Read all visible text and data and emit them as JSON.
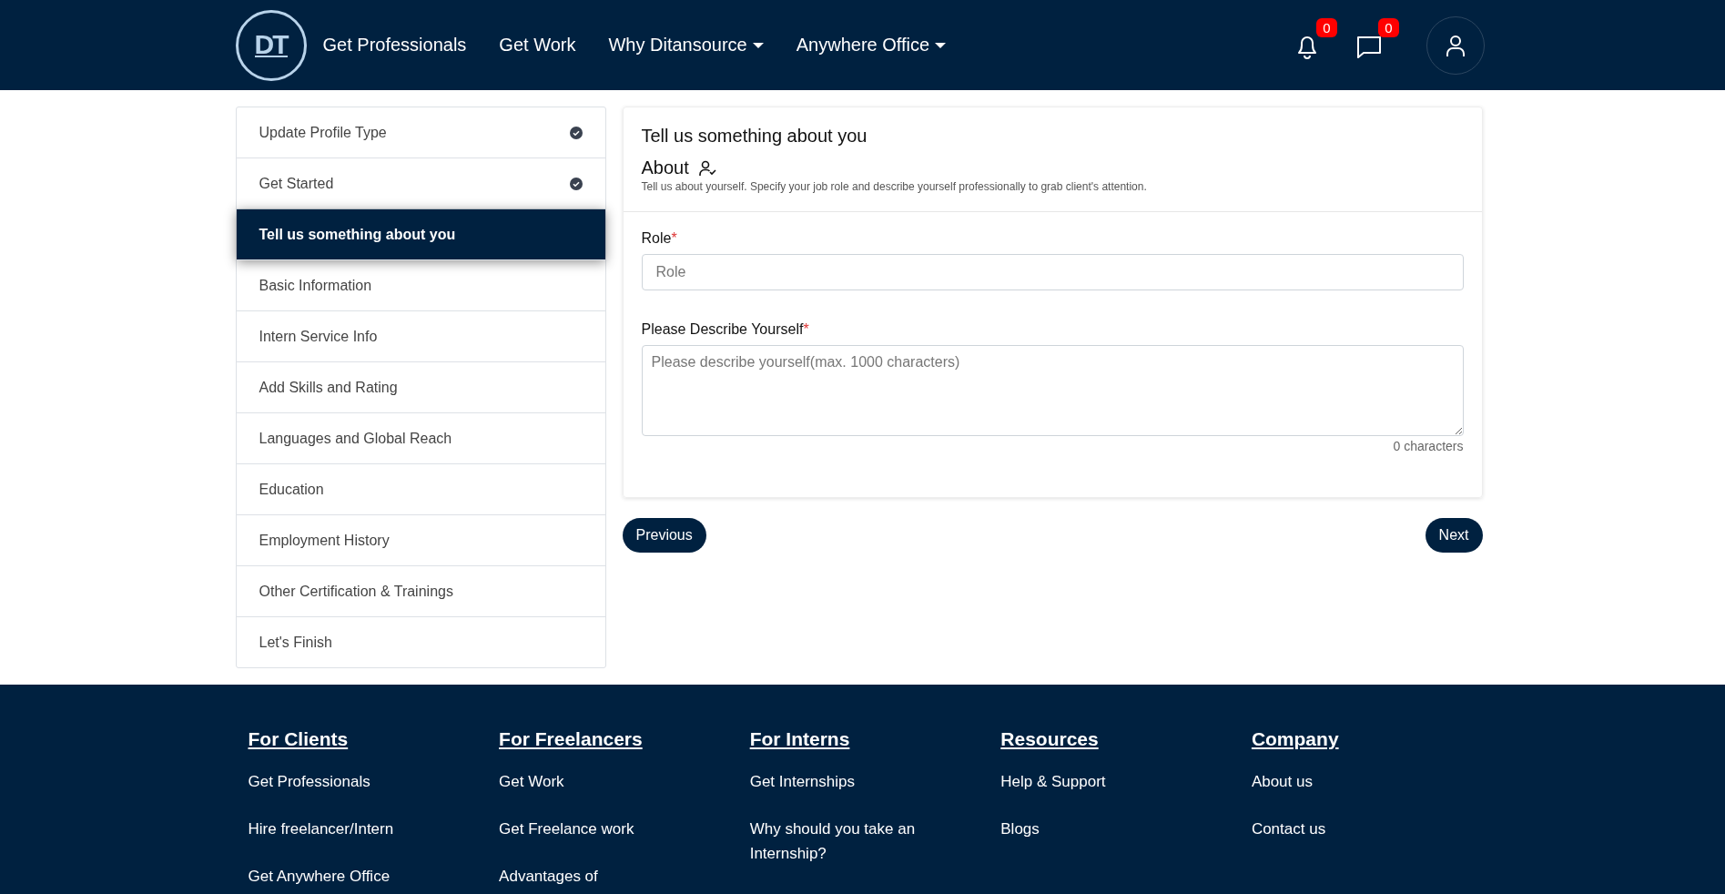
{
  "header": {
    "logo": "DT",
    "nav": [
      {
        "label": "Get Professionals",
        "dropdown": false
      },
      {
        "label": "Get Work",
        "dropdown": false
      },
      {
        "label": "Why Ditansource",
        "dropdown": true
      },
      {
        "label": "Anywhere Office",
        "dropdown": true
      }
    ],
    "notifications": [
      {
        "kind": "bell",
        "count": "0"
      },
      {
        "kind": "chat",
        "count": "0"
      }
    ]
  },
  "sidebar": {
    "items": [
      {
        "label": "Update Profile Type",
        "completed": true,
        "selected": false
      },
      {
        "label": "Get Started",
        "completed": true,
        "selected": false
      },
      {
        "label": "Tell us something about you",
        "completed": false,
        "selected": true
      },
      {
        "label": "Basic Information",
        "completed": false,
        "selected": false
      },
      {
        "label": "Intern Service Info",
        "completed": false,
        "selected": false
      },
      {
        "label": "Add Skills and Rating",
        "completed": false,
        "selected": false
      },
      {
        "label": "Languages and Global Reach",
        "completed": false,
        "selected": false
      },
      {
        "label": "Education",
        "completed": false,
        "selected": false
      },
      {
        "label": "Employment History",
        "completed": false,
        "selected": false
      },
      {
        "label": "Other Certification & Trainings",
        "completed": false,
        "selected": false
      },
      {
        "label": "Let's Finish",
        "completed": false,
        "selected": false
      }
    ]
  },
  "form": {
    "title": "Tell us something about you",
    "section": "About",
    "description": "Tell us about yourself. Specify your job role and describe yourself professionally to grab client's attention.",
    "fields": [
      {
        "kind": "input",
        "label": "Role",
        "required_mark": "*",
        "placeholder": "Role"
      },
      {
        "kind": "textarea",
        "label": "Please Describe Yourself",
        "required_mark": "*",
        "placeholder": "Please describe yourself(max. 1000 characters)",
        "counter": "0 characters"
      }
    ],
    "buttons": {
      "previous": "Previous",
      "next": "Next"
    }
  },
  "footer": {
    "columns": [
      {
        "heading": "For Clients",
        "links": [
          "Get Professionals",
          "Hire freelancer/Intern",
          "Get Anywhere Office"
        ]
      },
      {
        "heading": "For Freelancers",
        "links": [
          "Get Work",
          "Get Freelance work",
          "Advantages of"
        ]
      },
      {
        "heading": "For Interns",
        "links": [
          "Get Internships",
          "Why should you take an Internship?"
        ]
      },
      {
        "heading": "Resources",
        "links": [
          "Help & Support",
          "Blogs"
        ]
      },
      {
        "heading": "Company",
        "links": [
          "About us",
          "Contact us"
        ]
      }
    ]
  }
}
